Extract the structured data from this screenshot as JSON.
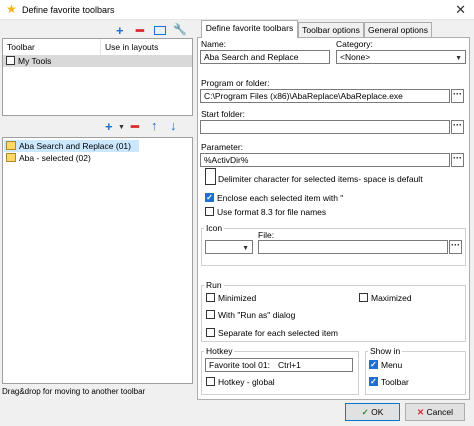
{
  "window": {
    "title": "Define favorite toolbars"
  },
  "left": {
    "columns": [
      "Toolbar",
      "Use in layouts"
    ],
    "toolbars": [
      {
        "name": "My Tools",
        "checked": false
      }
    ],
    "items": [
      {
        "label": "Aba Search and Replace  (01)",
        "selected": true
      },
      {
        "label": "Aba - selected  (02)",
        "selected": false
      }
    ],
    "status": "Drag&drop for moving to another toolbar"
  },
  "tabs": [
    "Define favorite toolbars",
    "Toolbar options",
    "General options"
  ],
  "form": {
    "name_label": "Name:",
    "name_value": "Aba Search and Replace",
    "category_label": "Category:",
    "category_value": "<None>",
    "program_label": "Program or folder:",
    "program_value": "C:\\Program Files (x86)\\AbaReplace\\AbaReplace.exe",
    "start_label": "Start folder:",
    "start_value": "",
    "param_label": "Parameter:",
    "param_value": "%ActivDir%",
    "delim_label": "Delimiter character for selected items- space is default",
    "enclose_label": "Enclose each selected item with \"",
    "format83_label": "Use format 8.3 for file names",
    "icon_label": "Icon",
    "file_label": "File:",
    "run_label": "Run",
    "minimized_label": "Minimized",
    "maximized_label": "Maximized",
    "runas_label": "With \"Run as\" dialog",
    "separate_label": "Separate for each selected item",
    "hotkey_label": "Hotkey",
    "hotkey_name": "Favorite tool 01:",
    "hotkey_value": "Ctrl+1",
    "hotkey_global_label": "Hotkey - global",
    "showin_label": "Show in",
    "menu_label": "Menu",
    "toolbar_label": "Toolbar"
  },
  "buttons": {
    "ok": "OK",
    "cancel": "Cancel"
  }
}
